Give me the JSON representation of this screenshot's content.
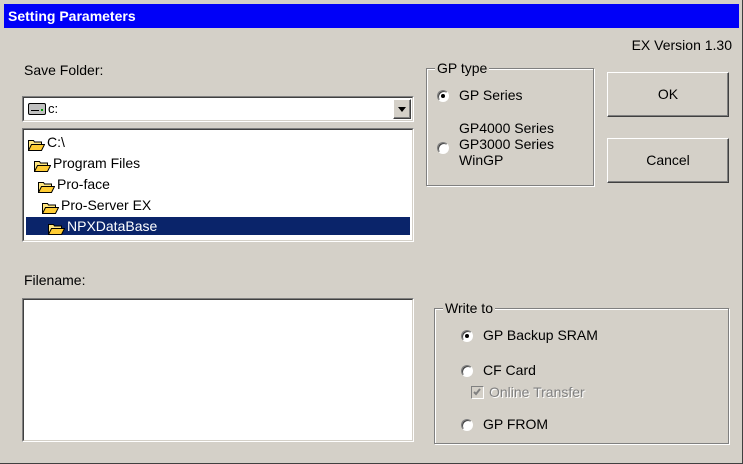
{
  "window": {
    "title": "Setting Parameters",
    "version": "EX Version 1.30"
  },
  "save_folder": {
    "label": "Save Folder:",
    "drive_value": "c:",
    "tree": [
      {
        "label": "C:\\"
      },
      {
        "label": "Program Files"
      },
      {
        "label": "Pro-face"
      },
      {
        "label": "Pro-Server EX"
      },
      {
        "label": "NPXDataBase",
        "selected": true
      }
    ]
  },
  "filename": {
    "label": "Filename:",
    "value": ""
  },
  "gp_type": {
    "title": "GP type",
    "options": [
      {
        "label": "GP Series",
        "checked": true
      },
      {
        "label_lines": [
          "GP4000 Series",
          "GP3000 Series",
          "WinGP"
        ],
        "checked": false
      }
    ]
  },
  "buttons": {
    "ok": "OK",
    "cancel": "Cancel"
  },
  "write_to": {
    "title": "Write to",
    "options": [
      {
        "label": "GP Backup SRAM",
        "checked": true
      },
      {
        "label": "CF Card",
        "checked": false
      },
      {
        "label": "GP FROM",
        "checked": false
      }
    ],
    "online_transfer": {
      "label": "Online Transfer",
      "checked": true,
      "enabled": false
    }
  },
  "colors": {
    "title_bar": "#0000f8",
    "dialog_bg": "#d4d0c8",
    "selection": "#0a246a"
  }
}
